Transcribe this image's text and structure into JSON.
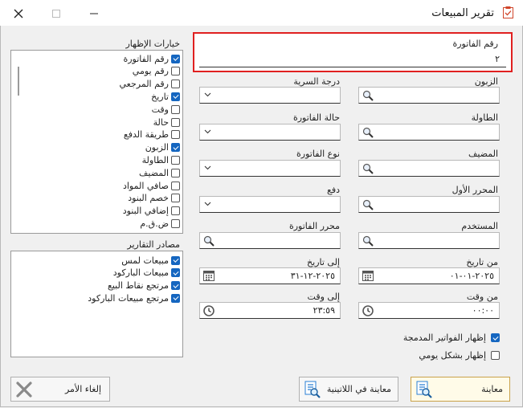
{
  "window": {
    "title": "تقرير المبيعات"
  },
  "display_options": {
    "title": "خيارات الإظهار",
    "items": [
      {
        "label": "رقم الفاتورة",
        "checked": true
      },
      {
        "label": "رقم يومي",
        "checked": false
      },
      {
        "label": "رقم المرجعي",
        "checked": false
      },
      {
        "label": "تاريخ",
        "checked": true
      },
      {
        "label": "وقت",
        "checked": false
      },
      {
        "label": "حالة",
        "checked": false
      },
      {
        "label": "طريقة الدفع",
        "checked": false
      },
      {
        "label": "الزبون",
        "checked": true
      },
      {
        "label": "الطاولة",
        "checked": false
      },
      {
        "label": "المضيف",
        "checked": false
      },
      {
        "label": "صافي المواد",
        "checked": false
      },
      {
        "label": "خصم البنود",
        "checked": false
      },
      {
        "label": "إضافي البنود",
        "checked": false
      },
      {
        "label": "ض.ق.م",
        "checked": false
      }
    ]
  },
  "report_sources": {
    "title": "مصادر التقارير",
    "items": [
      {
        "label": "مبيعات لمس",
        "checked": true
      },
      {
        "label": "مبيعات الباركود",
        "checked": true
      },
      {
        "label": "مرتجع نقاط البيع",
        "checked": true
      },
      {
        "label": "مرتجع مبيعات الباركود",
        "checked": true
      }
    ]
  },
  "invoice_number": {
    "label": "رقم الفاتورة",
    "value": "٢"
  },
  "fields": {
    "customer": {
      "label": "الزبون"
    },
    "table": {
      "label": "الطاولة"
    },
    "host": {
      "label": "المضيف"
    },
    "first_editor": {
      "label": "المحرر الأول"
    },
    "user": {
      "label": "المستخدم"
    },
    "invoice_editor": {
      "label": "محرر الفاتورة"
    },
    "security_level": {
      "label": "درجة السرية"
    },
    "invoice_status": {
      "label": "حالة الفاتورة"
    },
    "invoice_type": {
      "label": "نوع الفاتورة"
    },
    "payment": {
      "label": "دفع"
    },
    "from_date": {
      "label": "من تاريخ",
      "value": "٢٠٢٥-٠١-٠١"
    },
    "to_date": {
      "label": "إلى تاريخ",
      "value": "٢٠٢٥-١٢-٣١"
    },
    "from_time": {
      "label": "من وقت",
      "value": "٠٠:٠٠"
    },
    "to_time": {
      "label": "إلى وقت",
      "value": "٢٣:٥٩"
    }
  },
  "options": {
    "show_merged": {
      "label": "إظهار الفواتير المدمجة",
      "checked": true
    },
    "daily_view": {
      "label": "إظهار بشكل يومي",
      "checked": false
    }
  },
  "buttons": {
    "preview": "معاينة",
    "preview_latin": "معاينة في اللاتينية",
    "cancel": "إلغاء الأمر"
  },
  "colors": {
    "accent": "#1566c0",
    "highlight": "#e02020"
  }
}
